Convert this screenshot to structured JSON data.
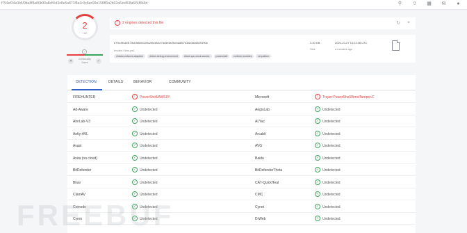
{
  "url": "f794ef34e0b5/9ba8f8a86b90a8c55d3e8e5a871f8a2c0c8ac99e15885a2b92a6/ed5/8a6f/4f8b6d",
  "top_icons": [
    "search-icon",
    "upload-icon",
    "apps-icon",
    "chat-icon",
    "account-icon"
  ],
  "score": {
    "detected": "2",
    "total": "/ 60"
  },
  "community": {
    "label_line1": "Community",
    "label_line2": "Score",
    "q": "?"
  },
  "alert": {
    "text": "2 engines detected this file"
  },
  "file": {
    "hash": "b7f4c9fca6f178cbfe60fcca9c2f6eeb3e7dc5e8e2beba6f67e3ac0838829190e",
    "name": "Invoke-Virus.ps1",
    "tags": [
      "checks-network-adapters",
      "detect-debug-environment",
      "direct-cpu-clock-access",
      "powershell",
      "runtime-modules",
      "url-pattern"
    ],
    "size": "3.40 KB",
    "size_label": "Size",
    "date": "2020-10-27 15:23:38 UTC",
    "ago": "a minutes ago"
  },
  "tabs": [
    "DETECTION",
    "DETAILS",
    "BEHAVIOR",
    "COMMUNITY"
  ],
  "rows": [
    {
      "l": "FIREHUNTER",
      "lr": "PowerShell/AMSI/Y",
      "lbad": true,
      "r": "Microsoft",
      "rr": "Trojan:PowerShell/AmsiTamper.C",
      "rbad": true
    },
    {
      "l": "Ad-Aware",
      "lr": "Undetected",
      "lbad": false,
      "r": "AegisLab",
      "rr": "Undetected",
      "rbad": false
    },
    {
      "l": "AhnLab-V3",
      "lr": "Undetected",
      "lbad": false,
      "r": "ALYac",
      "rr": "Undetected",
      "rbad": false
    },
    {
      "l": "Antiy-AVL",
      "lr": "Undetected",
      "lbad": false,
      "r": "Arcabit",
      "rr": "Undetected",
      "rbad": false
    },
    {
      "l": "Avast",
      "lr": "Undetected",
      "lbad": false,
      "r": "AVG",
      "rr": "Undetected",
      "rbad": false
    },
    {
      "l": "Avira (no cloud)",
      "lr": "Undetected",
      "lbad": false,
      "r": "Baidu",
      "rr": "Undetected",
      "rbad": false
    },
    {
      "l": "BitDefender",
      "lr": "Undetected",
      "lbad": false,
      "r": "BitDefenderTheta",
      "rr": "Undetected",
      "rbad": false
    },
    {
      "l": "Bkav",
      "lr": "Undetected",
      "lbad": false,
      "r": "CAT-QuickHeal",
      "rr": "Undetected",
      "rbad": false
    },
    {
      "l": "ClamAV",
      "lr": "Undetected",
      "lbad": false,
      "r": "CMC",
      "rr": "Undetected",
      "rbad": false
    },
    {
      "l": "Comodo",
      "lr": "Undetected",
      "lbad": false,
      "r": "Cynet",
      "rr": "Undetected",
      "rbad": false
    },
    {
      "l": "Cyren",
      "lr": "Undetected",
      "lbad": false,
      "r": "DrWeb",
      "rr": "Undetected",
      "rbad": false
    }
  ],
  "watermark": "FREEBUF",
  "colors": {
    "danger": "#e53e3e",
    "ok": "#3ca55c",
    "accent": "#2f5ec4"
  }
}
